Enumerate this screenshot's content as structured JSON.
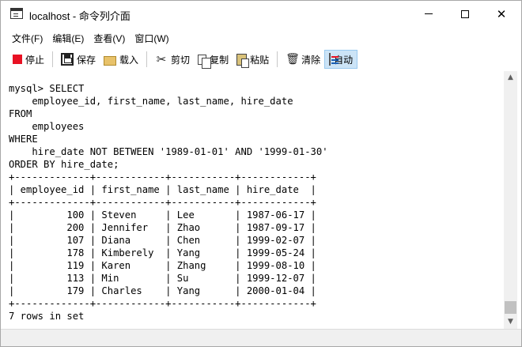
{
  "window": {
    "title": "localhost - 命令列介面"
  },
  "menu": [
    "文件(F)",
    "编辑(E)",
    "查看(V)",
    "窗口(W)"
  ],
  "toolbar": {
    "stop": "停止",
    "save": "保存",
    "load": "载入",
    "cut": "剪切",
    "copy": "复制",
    "paste": "粘贴",
    "clear": "清除",
    "auto": "自动"
  },
  "console": {
    "output": "mysql> SELECT\n    employee_id, first_name, last_name, hire_date\nFROM\n    employees\nWHERE\n    hire_date NOT BETWEEN '1989-01-01' AND '1999-01-30'\nORDER BY hire_date;\n+-------------+------------+-----------+------------+\n| employee_id | first_name | last_name | hire_date  |\n+-------------+------------+-----------+------------+\n|         100 | Steven     | Lee       | 1987-06-17 |\n|         200 | Jennifer   | Zhao      | 1987-09-17 |\n|         107 | Diana      | Chen      | 1999-02-07 |\n|         178 | Kimberely  | Yang      | 1999-05-24 |\n|         119 | Karen      | Zhang     | 1999-08-10 |\n|         113 | Min        | Su        | 1999-12-07 |\n|         179 | Charles    | Yang      | 2000-01-04 |\n+-------------+------------+-----------+------------+\n7 rows in set"
  },
  "icons": {
    "stop": "stop-icon",
    "save": "save-icon",
    "load": "load-icon",
    "cut": "scissors-icon",
    "copy": "copy-icon",
    "paste": "paste-icon",
    "clear": "trash-icon",
    "auto": "auto-icon"
  },
  "colors": {
    "stop": "#e81123",
    "active_button": "#cce4f7"
  }
}
